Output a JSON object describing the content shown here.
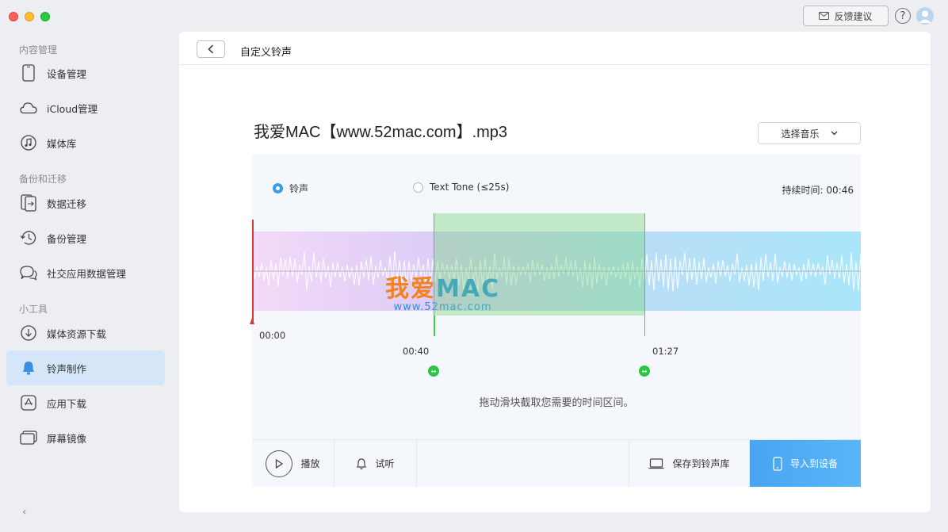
{
  "header": {
    "feedback_label": "反馈建议",
    "help_label": "?"
  },
  "sidebar": {
    "groups": [
      {
        "title": "内容管理",
        "items": [
          {
            "label": "设备管理",
            "icon": "phone-icon"
          },
          {
            "label": "iCloud管理",
            "icon": "cloud-icon"
          },
          {
            "label": "媒体库",
            "icon": "music-note-icon"
          }
        ]
      },
      {
        "title": "备份和迁移",
        "items": [
          {
            "label": "数据迁移",
            "icon": "transfer-icon"
          },
          {
            "label": "备份管理",
            "icon": "history-icon"
          },
          {
            "label": "社交应用数据管理",
            "icon": "chat-icon"
          }
        ]
      },
      {
        "title": "小工具",
        "items": [
          {
            "label": "媒体资源下载",
            "icon": "download-icon"
          },
          {
            "label": "铃声制作",
            "icon": "bell-icon",
            "active": true
          },
          {
            "label": "应用下载",
            "icon": "app-store-icon"
          },
          {
            "label": "屏幕镜像",
            "icon": "mirror-icon"
          }
        ]
      }
    ],
    "collapse_label": "‹"
  },
  "main": {
    "page_title": "自定义铃声",
    "file_title": "我爱MAC【www.52mac.com】.mp3",
    "select_music_label": "选择音乐",
    "options": {
      "ringtone_label": "铃声",
      "text_tone_label": "Text Tone (≤25s)",
      "selected": "ringtone"
    },
    "duration_label": "持续时间: 00:46",
    "times": {
      "start": "00:00",
      "sel_start": "00:40",
      "sel_end": "01:27"
    },
    "hint": "拖动滑块截取您需要的时间区间。",
    "watermark": {
      "main_cn": "我爱",
      "main_en": "MAC",
      "sub": "www.52mac.com"
    },
    "actions": {
      "play_label": "播放",
      "preview_label": "试听",
      "save_label": "保存到铃声库",
      "import_label": "导入到设备"
    }
  },
  "colors": {
    "accent": "#3a9be8",
    "selection": "#3fcf52",
    "playhead": "#e0323a",
    "active_nav": "#d4e6f8"
  }
}
